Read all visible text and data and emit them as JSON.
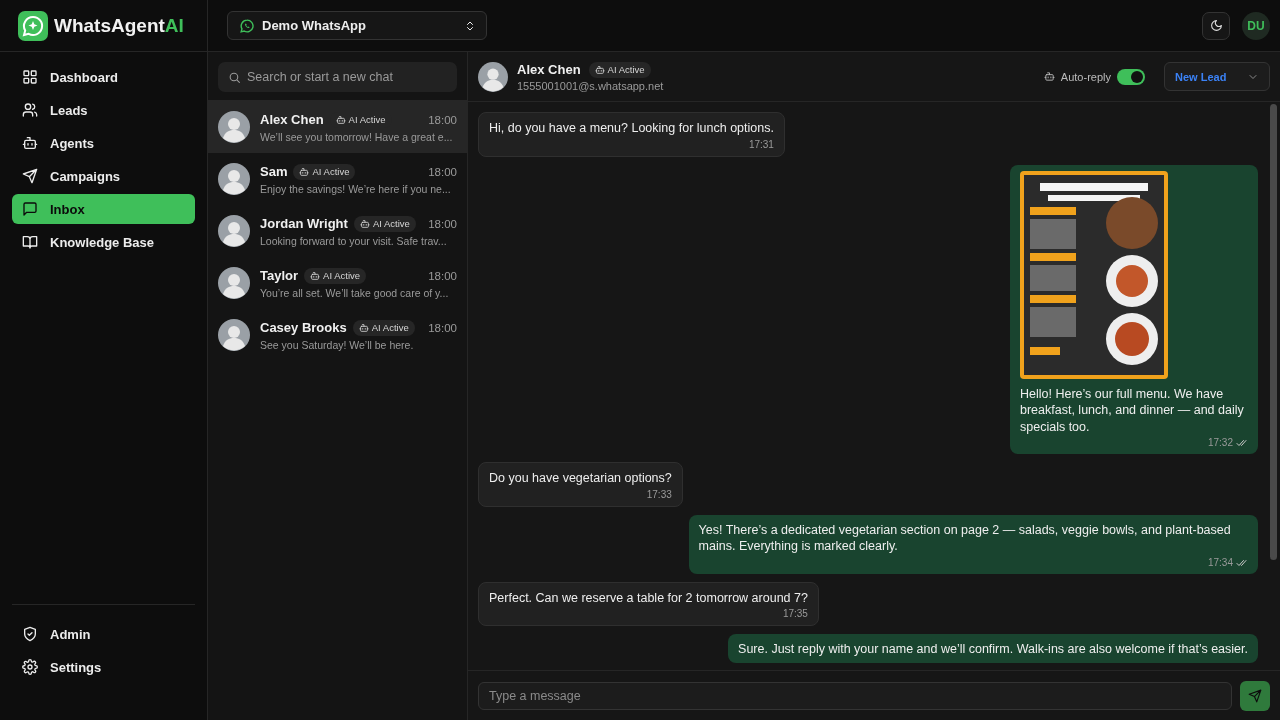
{
  "brand": {
    "name": "WhatsAgent",
    "accent": "AI"
  },
  "account_select": {
    "value": "Demo WhatsApp"
  },
  "user": {
    "initials": "DU"
  },
  "nav": [
    {
      "label": "Dashboard",
      "selected": false
    },
    {
      "label": "Leads",
      "selected": false
    },
    {
      "label": "Agents",
      "selected": false
    },
    {
      "label": "Campaigns",
      "selected": false
    },
    {
      "label": "Inbox",
      "selected": true
    },
    {
      "label": "Knowledge Base",
      "selected": false
    }
  ],
  "nav_bottom": [
    {
      "label": "Admin"
    },
    {
      "label": "Settings"
    }
  ],
  "search": {
    "placeholder": "Search or start a new chat"
  },
  "chats": [
    {
      "name": "Alex Chen",
      "badge": "AI Active",
      "time": "18:00",
      "preview": "We’ll see you tomorrow! Have a great e...",
      "selected": true
    },
    {
      "name": "Sam",
      "badge": "AI Active",
      "time": "18:00",
      "preview": "Enjoy the savings! We’re here if you ne...",
      "selected": false
    },
    {
      "name": "Jordan Wright",
      "badge": "AI Active",
      "time": "18:00",
      "preview": "Looking forward to your visit. Safe trav...",
      "selected": false
    },
    {
      "name": "Taylor",
      "badge": "AI Active",
      "time": "18:00",
      "preview": "You’re all set. We’ll take good care of y...",
      "selected": false
    },
    {
      "name": "Casey Brooks",
      "badge": "AI Active",
      "time": "18:00",
      "preview": "See you Saturday! We’ll be here.",
      "selected": false
    }
  ],
  "conversation": {
    "name": "Alex Chen",
    "badge": "AI Active",
    "phone": "1555001001@s.whatsapp.net",
    "auto_reply": {
      "label": "Auto-reply",
      "on": true
    },
    "status_select": {
      "value": "New Lead"
    },
    "messages": [
      {
        "kind": "incoming",
        "text": "Hi, do you have a menu? Looking for lunch options.",
        "time": "17:31"
      },
      {
        "kind": "outgoing",
        "text": "Hello! Here’s our full menu. We have breakfast, lunch, and dinner — and daily specials too.",
        "time": "17:32",
        "read": true
      },
      {
        "kind": "incoming",
        "text": "Do you have vegetarian options?",
        "time": "17:33"
      },
      {
        "kind": "outgoing",
        "text": "Yes! There’s a dedicated vegetarian section on page 2 — salads, veggie bowls, and plant-based mains. Everything is marked clearly.",
        "time": "17:34",
        "read": true
      },
      {
        "kind": "incoming",
        "text": "Perfect. Can we reserve a table for 2 tomorrow around 7?",
        "time": "17:35"
      },
      {
        "kind": "outgoing",
        "text": "Sure. Just reply with your name and we’ll confirm. Walk-ins are also welcome if that’s easier."
      }
    ]
  },
  "composer": {
    "placeholder": "Type a message"
  }
}
